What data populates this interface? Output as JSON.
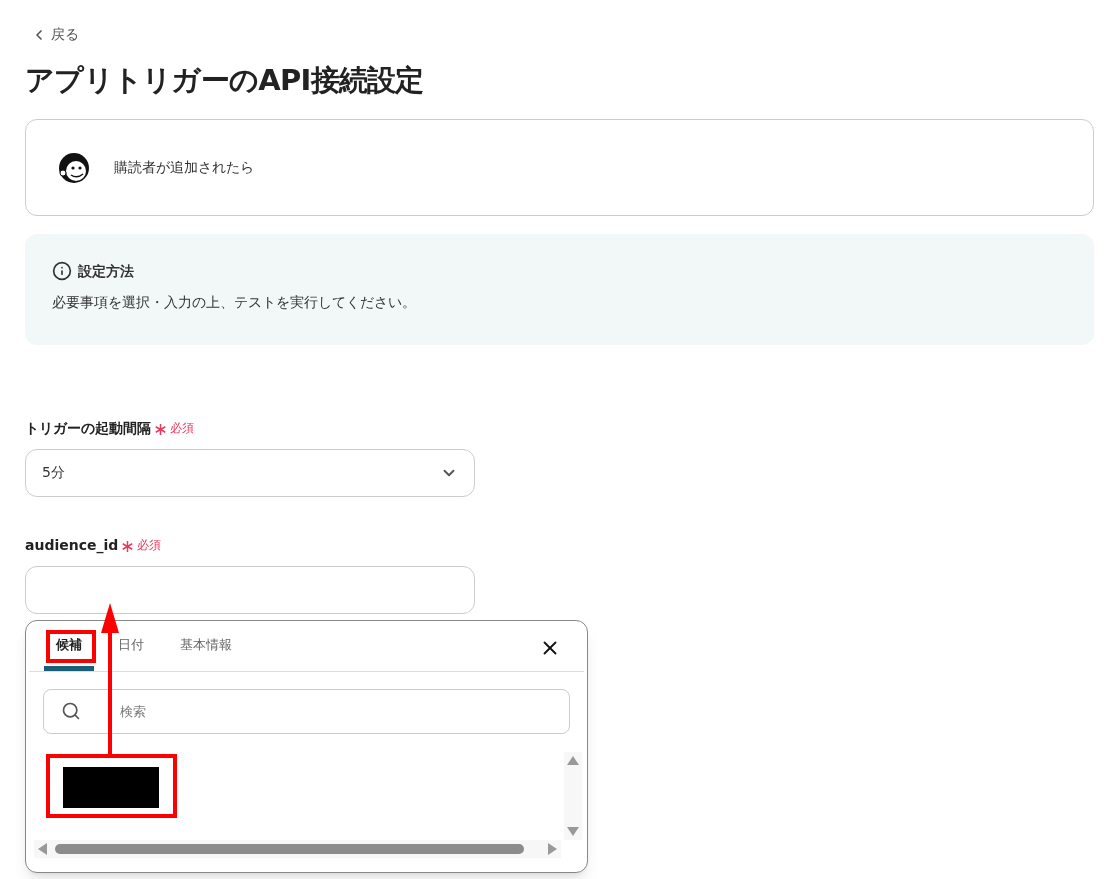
{
  "back_link": "戻る",
  "title": "アプリトリガーのAPI接続設定",
  "trigger": {
    "label": "購読者が追加されたら"
  },
  "info": {
    "title": "設定方法",
    "text": "必要事項を選択・入力の上、テストを実行してください。"
  },
  "fields": [
    {
      "kind": "select",
      "label": "トリガーの起動間隔",
      "required": "必須",
      "value": "5分"
    },
    {
      "kind": "text",
      "label": "audience_id",
      "required": "必須"
    }
  ],
  "popup": {
    "tabs": [
      {
        "label": "候補",
        "selected": true
      },
      {
        "label": "日付",
        "selected": false
      },
      {
        "label": "基本情報",
        "selected": false
      }
    ],
    "search": {
      "placeholder": "検索"
    }
  }
}
